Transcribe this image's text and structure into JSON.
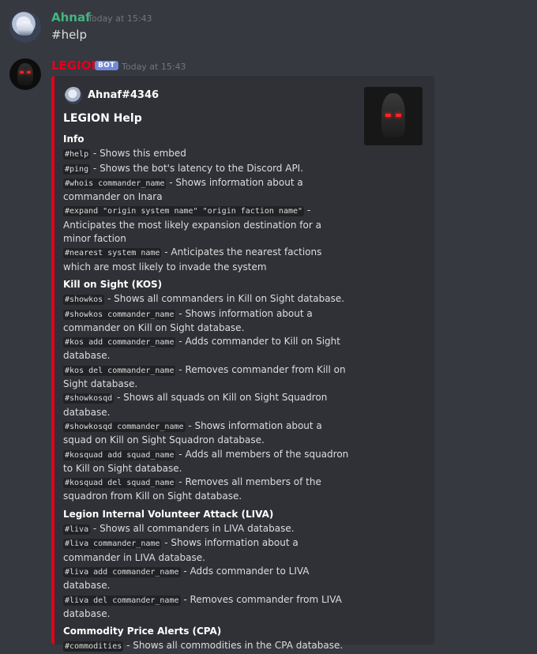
{
  "messages": {
    "user": {
      "name": "Ahnaf",
      "name_color": "#43b581",
      "timestamp": "Today at 15:43",
      "text": "#help"
    },
    "bot": {
      "name": "LEGION",
      "name_color": "#e3001b",
      "tag": "BOT",
      "timestamp": "Today at 15:43"
    }
  },
  "embed": {
    "accent_color": "#e3001b",
    "author": "Ahnaf#4346",
    "title": "LEGION Help",
    "fields": [
      {
        "name": "Info",
        "entries": [
          {
            "cmd": "#help",
            "desc": " - Shows this embed"
          },
          {
            "cmd": "#ping",
            "desc": " - Shows the bot's latency to the Discord API."
          },
          {
            "cmd": "#whois commander_name",
            "desc": " - Shows information about a commander on Inara"
          },
          {
            "cmd": "#expand \"origin system name\" \"origin faction name\"",
            "desc": " - Anticipates the most likely expansion destination for a minor faction"
          },
          {
            "cmd": "#nearest system name",
            "desc": " - Anticipates the nearest factions which are most likely to invade the system"
          }
        ]
      },
      {
        "name": "Kill on Sight (KOS)",
        "entries": [
          {
            "cmd": "#showkos",
            "desc": " - Shows all commanders in Kill on Sight database."
          },
          {
            "cmd": "#showkos commander_name",
            "desc": " - Shows information about a commander on Kill on Sight database."
          },
          {
            "cmd": "#kos add commander_name",
            "desc": " - Adds commander to Kill on Sight database."
          },
          {
            "cmd": "#kos del commander_name",
            "desc": " - Removes commander from Kill on Sight database."
          },
          {
            "cmd": "#showkosqd",
            "desc": " - Shows all squads on Kill on Sight Squadron database."
          },
          {
            "cmd": "#showkosqd commander_name",
            "desc": " - Shows information about a squad on Kill on Sight Squadron database."
          },
          {
            "cmd": "#kosquad add squad_name",
            "desc": " - Adds all members of the squadron to Kill on Sight database."
          },
          {
            "cmd": "#kosquad del squad_name",
            "desc": " - Removes all members of the squadron from Kill on Sight database."
          }
        ]
      },
      {
        "name": "Legion Internal Volunteer Attack (LIVA)",
        "entries": [
          {
            "cmd": "#liva",
            "desc": " - Shows all commanders in LIVA database."
          },
          {
            "cmd": "#liva commander_name",
            "desc": " - Shows information about a commander in LIVA database."
          },
          {
            "cmd": "#liva add commander_name",
            "desc": " - Adds commander to LIVA database."
          },
          {
            "cmd": "#liva del commander_name",
            "desc": " - Removes commander from LIVA database."
          }
        ]
      },
      {
        "name": "Commodity Price Alerts (CPA)",
        "entries": [
          {
            "cmd": "#commodities",
            "desc": " - Shows all commodities in the CPA database."
          }
        ]
      }
    ]
  }
}
